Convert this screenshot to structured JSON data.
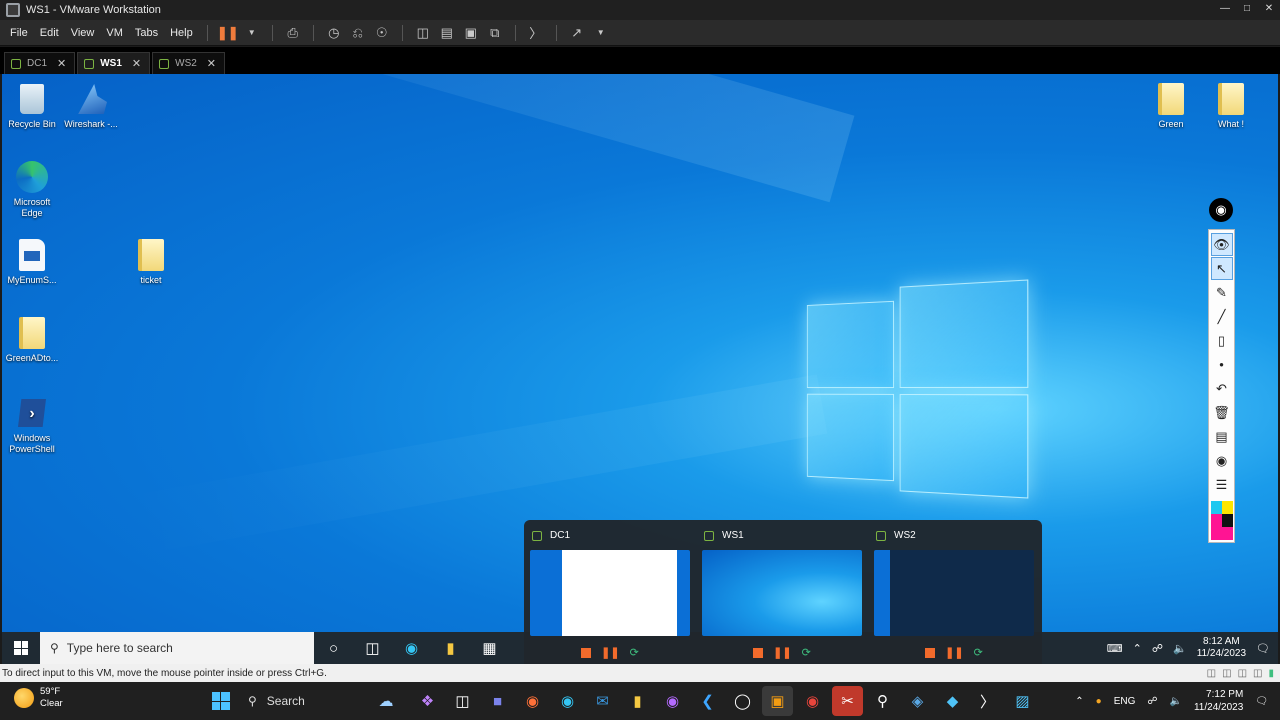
{
  "window": {
    "title": "WS1 - VMware Workstation"
  },
  "menu": {
    "items": [
      "File",
      "Edit",
      "View",
      "VM",
      "Tabs",
      "Help"
    ]
  },
  "tabs": [
    {
      "label": "DC1",
      "active": false
    },
    {
      "label": "WS1",
      "active": true
    },
    {
      "label": "WS2",
      "active": false
    }
  ],
  "desktop": {
    "icons": [
      {
        "label": "Recycle Bin",
        "icon": "recycle-bin-icon"
      },
      {
        "label": "Wireshark -...",
        "icon": "wireshark-icon"
      },
      {
        "label": "Microsoft Edge",
        "icon": "edge-icon"
      },
      {
        "label": "MyEnumS...",
        "icon": "script-icon"
      },
      {
        "label": "ticket",
        "icon": "folder-icon"
      },
      {
        "label": "GreenADto...",
        "icon": "folder-icon"
      },
      {
        "label": "Windows PowerShell",
        "icon": "powershell-icon"
      },
      {
        "label": "Green",
        "icon": "folder-icon"
      },
      {
        "label": "What !",
        "icon": "folder-icon"
      }
    ]
  },
  "guest_taskbar": {
    "search_placeholder": "Type here to search",
    "time": "8:12 AM",
    "date": "11/24/2023"
  },
  "thumbnails": [
    {
      "label": "DC1"
    },
    {
      "label": "WS1"
    },
    {
      "label": "WS2"
    }
  ],
  "statusbar": {
    "text": "To direct input to this VM, move the mouse pointer inside or press Ctrl+G."
  },
  "host_taskbar": {
    "weather_temp": "59°F",
    "weather_desc": "Clear",
    "search_label": "Search",
    "language": "ENG",
    "time": "7:12 PM",
    "date": "11/24/2023"
  },
  "colors": {
    "accent_orange": "#f26b2c",
    "vm_green": "#7cb342",
    "desktop_blue": "#0a78d8"
  }
}
